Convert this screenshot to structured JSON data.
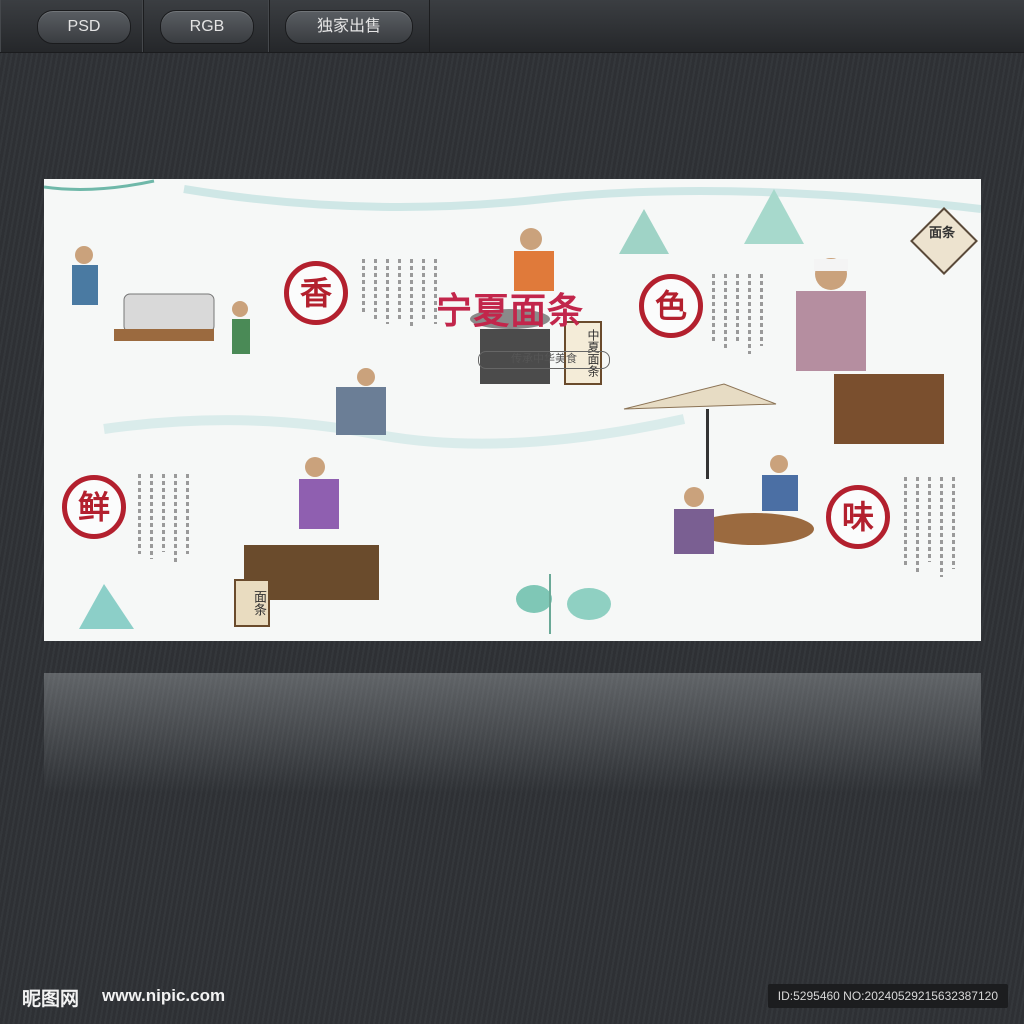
{
  "toolbar": {
    "tags": [
      "PSD",
      "RGB",
      "独家出售"
    ]
  },
  "poster": {
    "title": "宁夏面条",
    "subtitle": "传承中华美食",
    "seals": [
      "香",
      "色",
      "鲜",
      "味"
    ],
    "sign_stand": "中夏面条",
    "sign_hanging": "面条",
    "sign_bench": "面条"
  },
  "footer": {
    "logo": "昵图网",
    "url": "www.nipic.com",
    "id_text": "ID:5295460 NO:20240529215632387120"
  },
  "colors": {
    "accent_red": "#b3202e",
    "title_magenta": "#c2264b",
    "background": "#2f3236"
  }
}
